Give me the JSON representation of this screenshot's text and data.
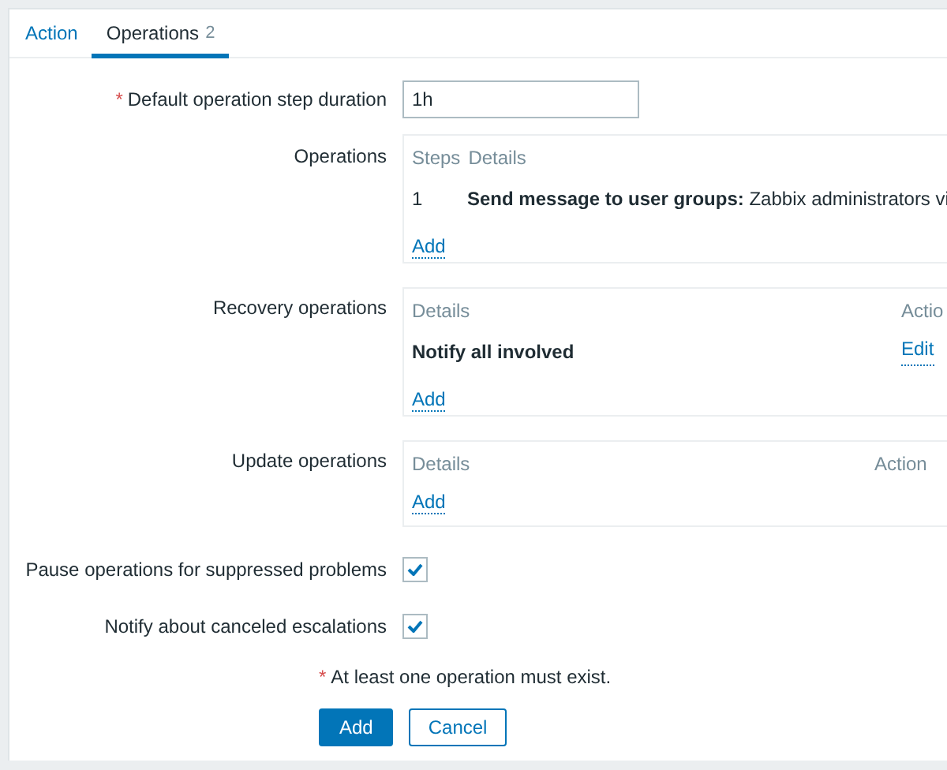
{
  "tabs": [
    {
      "label": "Action",
      "selected": false
    },
    {
      "label": "Operations",
      "count": "2",
      "selected": true
    }
  ],
  "step_duration": {
    "label": "Default operation step duration",
    "required_mark": "*",
    "value": "1h"
  },
  "operations": {
    "label": "Operations",
    "columns": [
      "Steps",
      "Details"
    ],
    "rows": [
      {
        "steps": "1",
        "details": "**Send message to user groups:** Zabbix administrators vi"
      }
    ],
    "add_link": "Add"
  },
  "recovery_operations": {
    "label": "Recovery operations",
    "columns": [
      "Details",
      "Actio"
    ],
    "rows": [
      {
        "details": "Notify all involved",
        "action": "Edit"
      }
    ],
    "add_link": "Add"
  },
  "update_operations": {
    "label": "Update operations",
    "columns": [
      "Details",
      "Action"
    ],
    "add_link": "Add"
  },
  "checkboxes": [
    {
      "label": "Pause operations for suppressed problems",
      "checked": true
    },
    {
      "label": "Notify about canceled escalations",
      "checked": true
    }
  ],
  "note": {
    "required_mark": "*",
    "text": "At least one operation must exist."
  },
  "buttons": [
    {
      "label": "Add",
      "kind": "primary"
    },
    {
      "label": "Cancel",
      "kind": "secondary"
    }
  ]
}
